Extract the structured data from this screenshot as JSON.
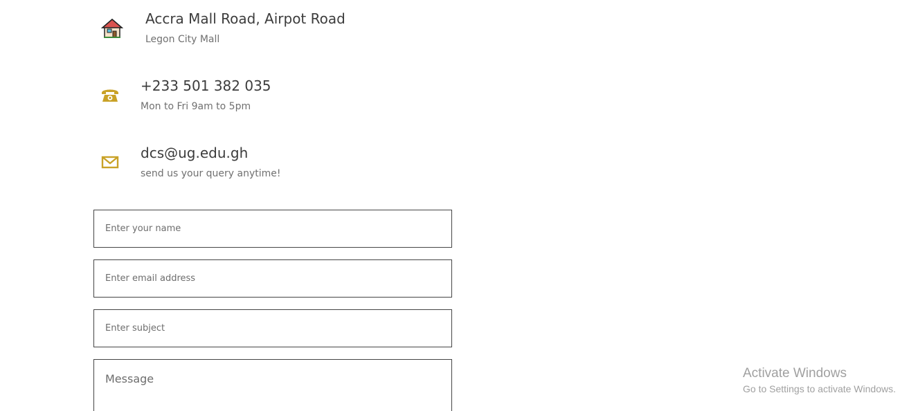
{
  "contact": {
    "address": {
      "title": "Accra Mall Road, Airpot Road",
      "subtitle": "Legon City Mall",
      "icon": "house-icon"
    },
    "phone": {
      "title": "+233 501 382 035",
      "subtitle": "Mon to Fri 9am to 5pm",
      "icon": "telephone-icon",
      "icon_color": "#c9a227"
    },
    "email": {
      "title": "dcs@ug.edu.gh",
      "subtitle": "send us your query anytime!",
      "icon": "envelope-icon",
      "icon_color": "#c9a227"
    }
  },
  "form": {
    "name_placeholder": "Enter your name",
    "email_placeholder": "Enter email address",
    "subject_placeholder": "Enter subject",
    "message_placeholder": "Message"
  },
  "watermark": {
    "title": "Activate Windows",
    "subtitle": "Go to Settings to activate Windows."
  }
}
